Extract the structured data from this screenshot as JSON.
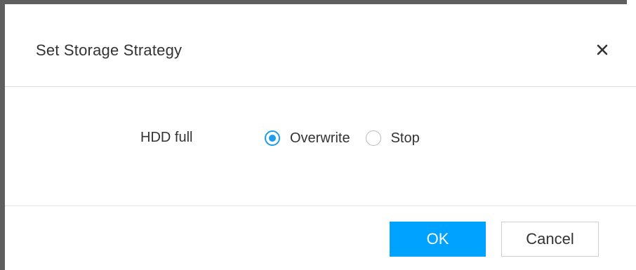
{
  "dialog": {
    "title": "Set Storage Strategy",
    "close_icon": "close-icon"
  },
  "form": {
    "field_label": "HDD full",
    "options": [
      {
        "label": "Overwrite",
        "selected": true
      },
      {
        "label": "Stop",
        "selected": false
      }
    ]
  },
  "footer": {
    "ok_label": "OK",
    "cancel_label": "Cancel"
  },
  "colors": {
    "accent": "#00a2ff",
    "radio_selected": "#1e9cf0",
    "frame": "#5f5f5f"
  }
}
